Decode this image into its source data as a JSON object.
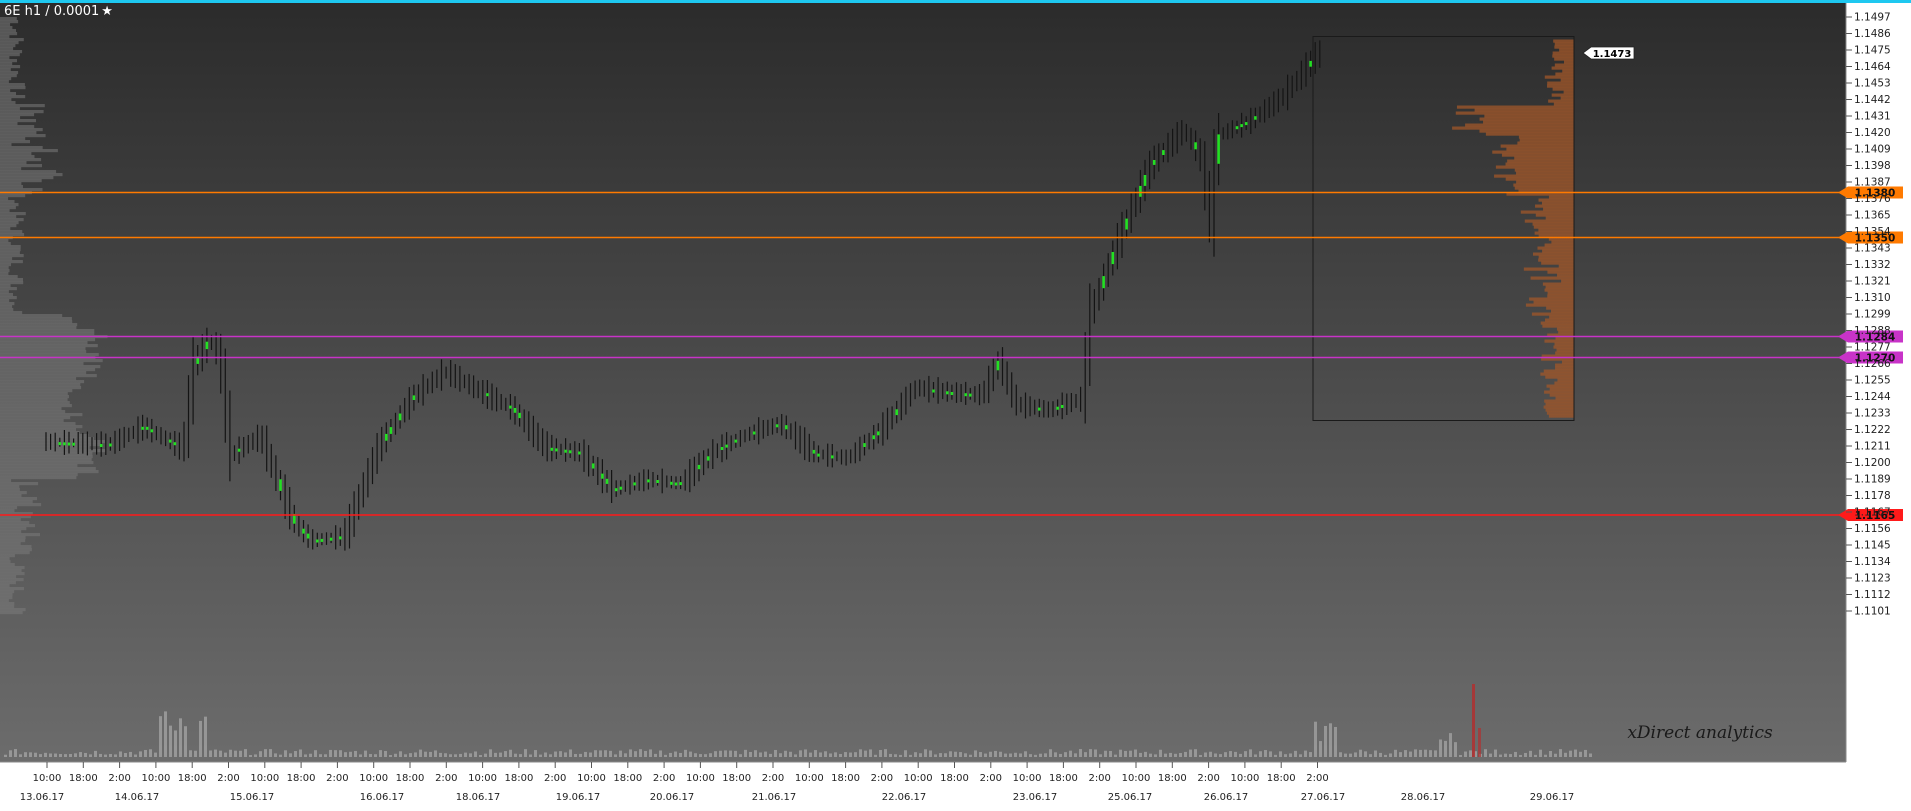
{
  "chart_title": "6E h1 / 0.0001",
  "title_icon": "star-icon",
  "watermark": "xDirect analytics",
  "colors": {
    "top_border": "#1ec8f0",
    "support": "#ff7a00",
    "magenta": "#c833c8",
    "red": "#ff1a1a",
    "up_candle": "#22e022",
    "bar": "#141414",
    "profile_left": "#7a7a7a",
    "profile_right": "#a0572a",
    "volume": "#a9a9a9",
    "volume_spike": "#b03030"
  },
  "chart_data": {
    "type": "line",
    "instrument": "6E",
    "timeframe": "h1",
    "tick_size": "0.0001",
    "y_axis": {
      "range": [
        1.1093,
        1.1505
      ],
      "ticks": [
        "1.1497",
        "1.1486",
        "1.1475",
        "1.1464",
        "1.1453",
        "1.1442",
        "1.1431",
        "1.1420",
        "1.1409",
        "1.1398",
        "1.1387",
        "1.1376",
        "1.1365",
        "1.1354",
        "1.1343",
        "1.1332",
        "1.1321",
        "1.1310",
        "1.1299",
        "1.1288",
        "1.1277",
        "1.1266",
        "1.1255",
        "1.1244",
        "1.1233",
        "1.1222",
        "1.1211",
        "1.1200",
        "1.1189",
        "1.1178",
        "1.1167",
        "1.1156",
        "1.1145",
        "1.1134",
        "1.1123",
        "1.1112",
        "1.1101"
      ]
    },
    "x_axis": {
      "time_labels": [
        "10:00",
        "18:00",
        "2:00",
        "10:00",
        "18:00",
        "2:00",
        "10:00",
        "18:00",
        "2:00",
        "10:00",
        "18:00",
        "2:00",
        "10:00",
        "18:00",
        "2:00",
        "10:00",
        "18:00",
        "2:00",
        "10:00",
        "18:00",
        "2:00",
        "10:00",
        "18:00",
        "2:00",
        "10:00",
        "18:00",
        "2:00",
        "10:00",
        "18:00",
        "2:00",
        "10:00",
        "18:00",
        "2:00",
        "10:00",
        "18:00",
        "2:00"
      ],
      "date_labels": [
        "13.06.17",
        "14.06.17",
        "15.06.17",
        "16.06.17",
        "18.06.17",
        "19.06.17",
        "20.06.17",
        "21.06.17",
        "22.06.17",
        "23.06.17",
        "25.06.17",
        "26.06.17",
        "27.06.17",
        "28.06.17",
        "29.06.17"
      ]
    },
    "price_path": [
      {
        "t": 0,
        "p": 1.1214
      },
      {
        "t": 2,
        "p": 1.1212
      },
      {
        "t": 3,
        "p": 1.1224
      },
      {
        "t": 4.2,
        "p": 1.1209
      },
      {
        "t": 4.5,
        "p": 1.1265
      },
      {
        "t": 5,
        "p": 1.1283
      },
      {
        "t": 5.3,
        "p": 1.1268
      },
      {
        "t": 5.6,
        "p": 1.1205
      },
      {
        "t": 6.5,
        "p": 1.1218
      },
      {
        "t": 7,
        "p": 1.1188
      },
      {
        "t": 7.5,
        "p": 1.116
      },
      {
        "t": 8,
        "p": 1.1148
      },
      {
        "t": 9,
        "p": 1.1151
      },
      {
        "t": 10,
        "p": 1.121
      },
      {
        "t": 11,
        "p": 1.1243
      },
      {
        "t": 12,
        "p": 1.1261
      },
      {
        "t": 13,
        "p": 1.1248
      },
      {
        "t": 14,
        "p": 1.1236
      },
      {
        "t": 15,
        "p": 1.121
      },
      {
        "t": 16,
        "p": 1.1207
      },
      {
        "t": 17,
        "p": 1.1182
      },
      {
        "t": 18,
        "p": 1.1189
      },
      {
        "t": 19,
        "p": 1.1186
      },
      {
        "t": 20,
        "p": 1.1207
      },
      {
        "t": 21,
        "p": 1.1219
      },
      {
        "t": 22,
        "p": 1.1226
      },
      {
        "t": 23,
        "p": 1.1206
      },
      {
        "t": 24,
        "p": 1.1203
      },
      {
        "t": 25,
        "p": 1.1222
      },
      {
        "t": 26,
        "p": 1.125
      },
      {
        "t": 27,
        "p": 1.1247
      },
      {
        "t": 28,
        "p": 1.1245
      },
      {
        "t": 28.5,
        "p": 1.1268
      },
      {
        "t": 29,
        "p": 1.1239
      },
      {
        "t": 30,
        "p": 1.1235
      },
      {
        "t": 31,
        "p": 1.1243
      },
      {
        "t": 31.2,
        "p": 1.1298
      },
      {
        "t": 32,
        "p": 1.1345
      },
      {
        "t": 33,
        "p": 1.1398
      },
      {
        "t": 34,
        "p": 1.1422
      },
      {
        "t": 34.5,
        "p": 1.1405
      },
      {
        "t": 34.8,
        "p": 1.136
      },
      {
        "t": 35,
        "p": 1.1418
      },
      {
        "t": 36,
        "p": 1.1428
      },
      {
        "t": 37,
        "p": 1.1445
      },
      {
        "t": 38,
        "p": 1.1473
      }
    ],
    "last_price": "1.1473",
    "levels": [
      {
        "price": "1.1380",
        "color": "orange"
      },
      {
        "price": "1.1350",
        "color": "orange"
      },
      {
        "price": "1.1284",
        "color": "magenta"
      },
      {
        "price": "1.1270",
        "color": "magenta"
      },
      {
        "price": "1.1165",
        "color": "red"
      }
    ],
    "range_box": {
      "t_start": 31,
      "t_end": 38,
      "low": 1.1228,
      "high": 1.1484
    },
    "legend": "none",
    "grid": false
  }
}
